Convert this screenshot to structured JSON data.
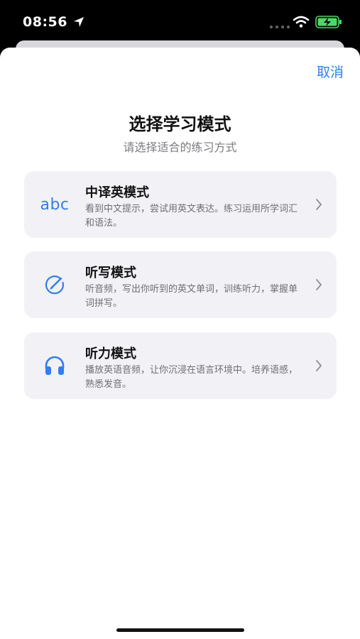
{
  "status_bar": {
    "time": "08:56"
  },
  "header": {
    "cancel_label": "取消"
  },
  "page": {
    "title": "选择学习模式",
    "subtitle": "请选择适合的练习方式"
  },
  "modes": [
    {
      "icon_text": "abc",
      "title": "中译英模式",
      "description": "看到中文提示，尝试用英文表达。练习运用所学词汇和语法。"
    },
    {
      "title": "听写模式",
      "description": "听音频，写出你听到的英文单词，训练听力，掌握单词拼写。"
    },
    {
      "title": "听力模式",
      "description": "播放英语音频，让你沉浸在语言环境中。培养语感，熟悉发音。"
    }
  ],
  "colors": {
    "accent": "#2f7ef6",
    "card_bg": "#f2f2f6",
    "battery": "#4cd964"
  }
}
